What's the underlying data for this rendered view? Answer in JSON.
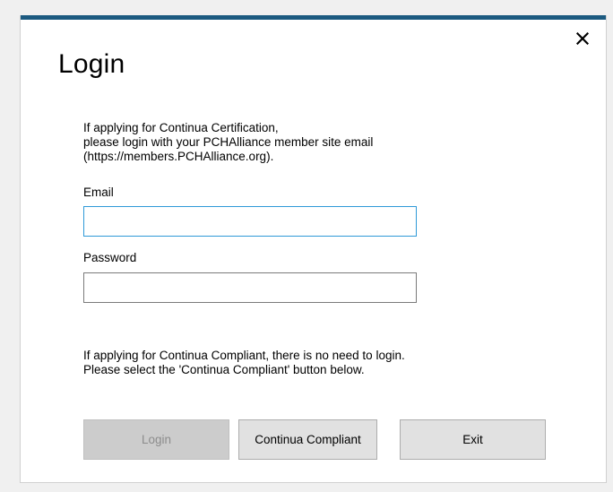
{
  "dialog": {
    "title": "Login",
    "close_icon": "close-icon",
    "accent_color": "#1c5a80"
  },
  "certification_info": {
    "line1": "If applying for Continua Certification,",
    "line2": "please login with your PCHAlliance member site email",
    "line3": "(https://members.PCHAlliance.org)."
  },
  "email": {
    "label": "Email",
    "value": "",
    "focus_color": "#2f9ad8"
  },
  "password": {
    "label": "Password",
    "value": ""
  },
  "compliant_info": {
    "line1": "If applying for Continua Compliant, there is no need to login.",
    "line2": "Please select the 'Continua Compliant' button below."
  },
  "buttons": {
    "login": "Login",
    "continua_compliant": "Continua Compliant",
    "exit": "Exit"
  }
}
